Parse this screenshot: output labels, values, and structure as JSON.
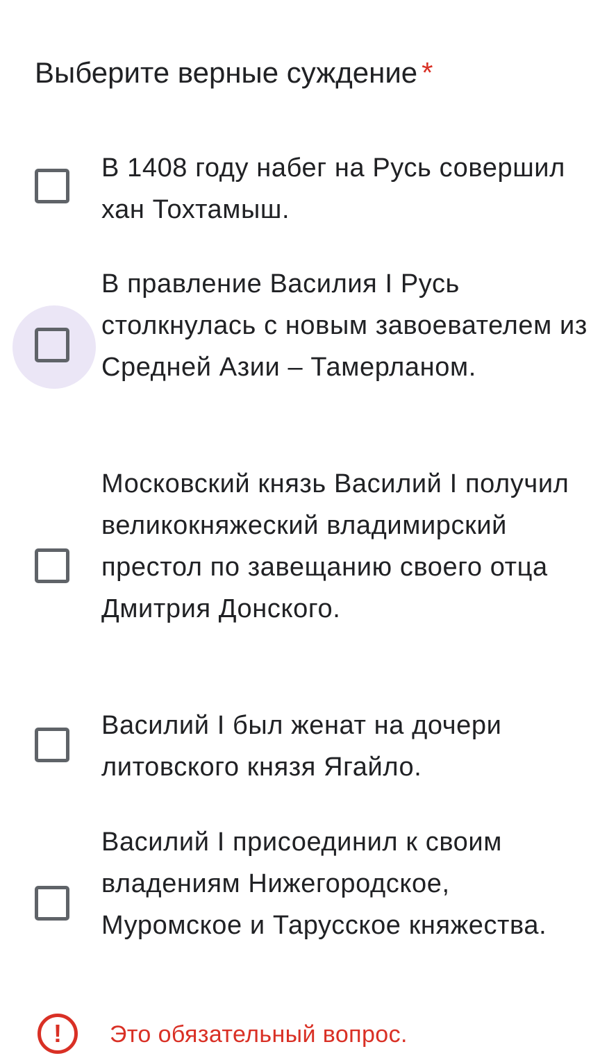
{
  "question": {
    "title": "Выберите верные суждение",
    "required_mark": "*"
  },
  "options": [
    {
      "label": "В 1408 году набег на Русь совершил хан Тохтамыш.",
      "checked": false
    },
    {
      "label": "В правление Василия I Русь столкнулась с новым завоевателем из Средней Азии – Тамерланом.",
      "checked": false,
      "focused": true
    },
    {
      "label": "Московский князь Василий I получил великокняжеский владимирский престол по завещанию своего отца Дмитрия Донского.",
      "checked": false
    },
    {
      "label": "Василий I был женат на дочери литовского князя Ягайло.",
      "checked": false
    },
    {
      "label": "Василий I присоединил к своим владениям Нижегородское, Муромское и Тарусское княжества.",
      "checked": false
    }
  ],
  "validation": {
    "icon": "error-icon",
    "icon_glyph": "!",
    "message": "Это обязательный вопрос."
  },
  "colors": {
    "required": "#d93025",
    "error": "#d93025",
    "checkbox_border": "#5f6368",
    "focus_ring": "#ebe6f6"
  }
}
